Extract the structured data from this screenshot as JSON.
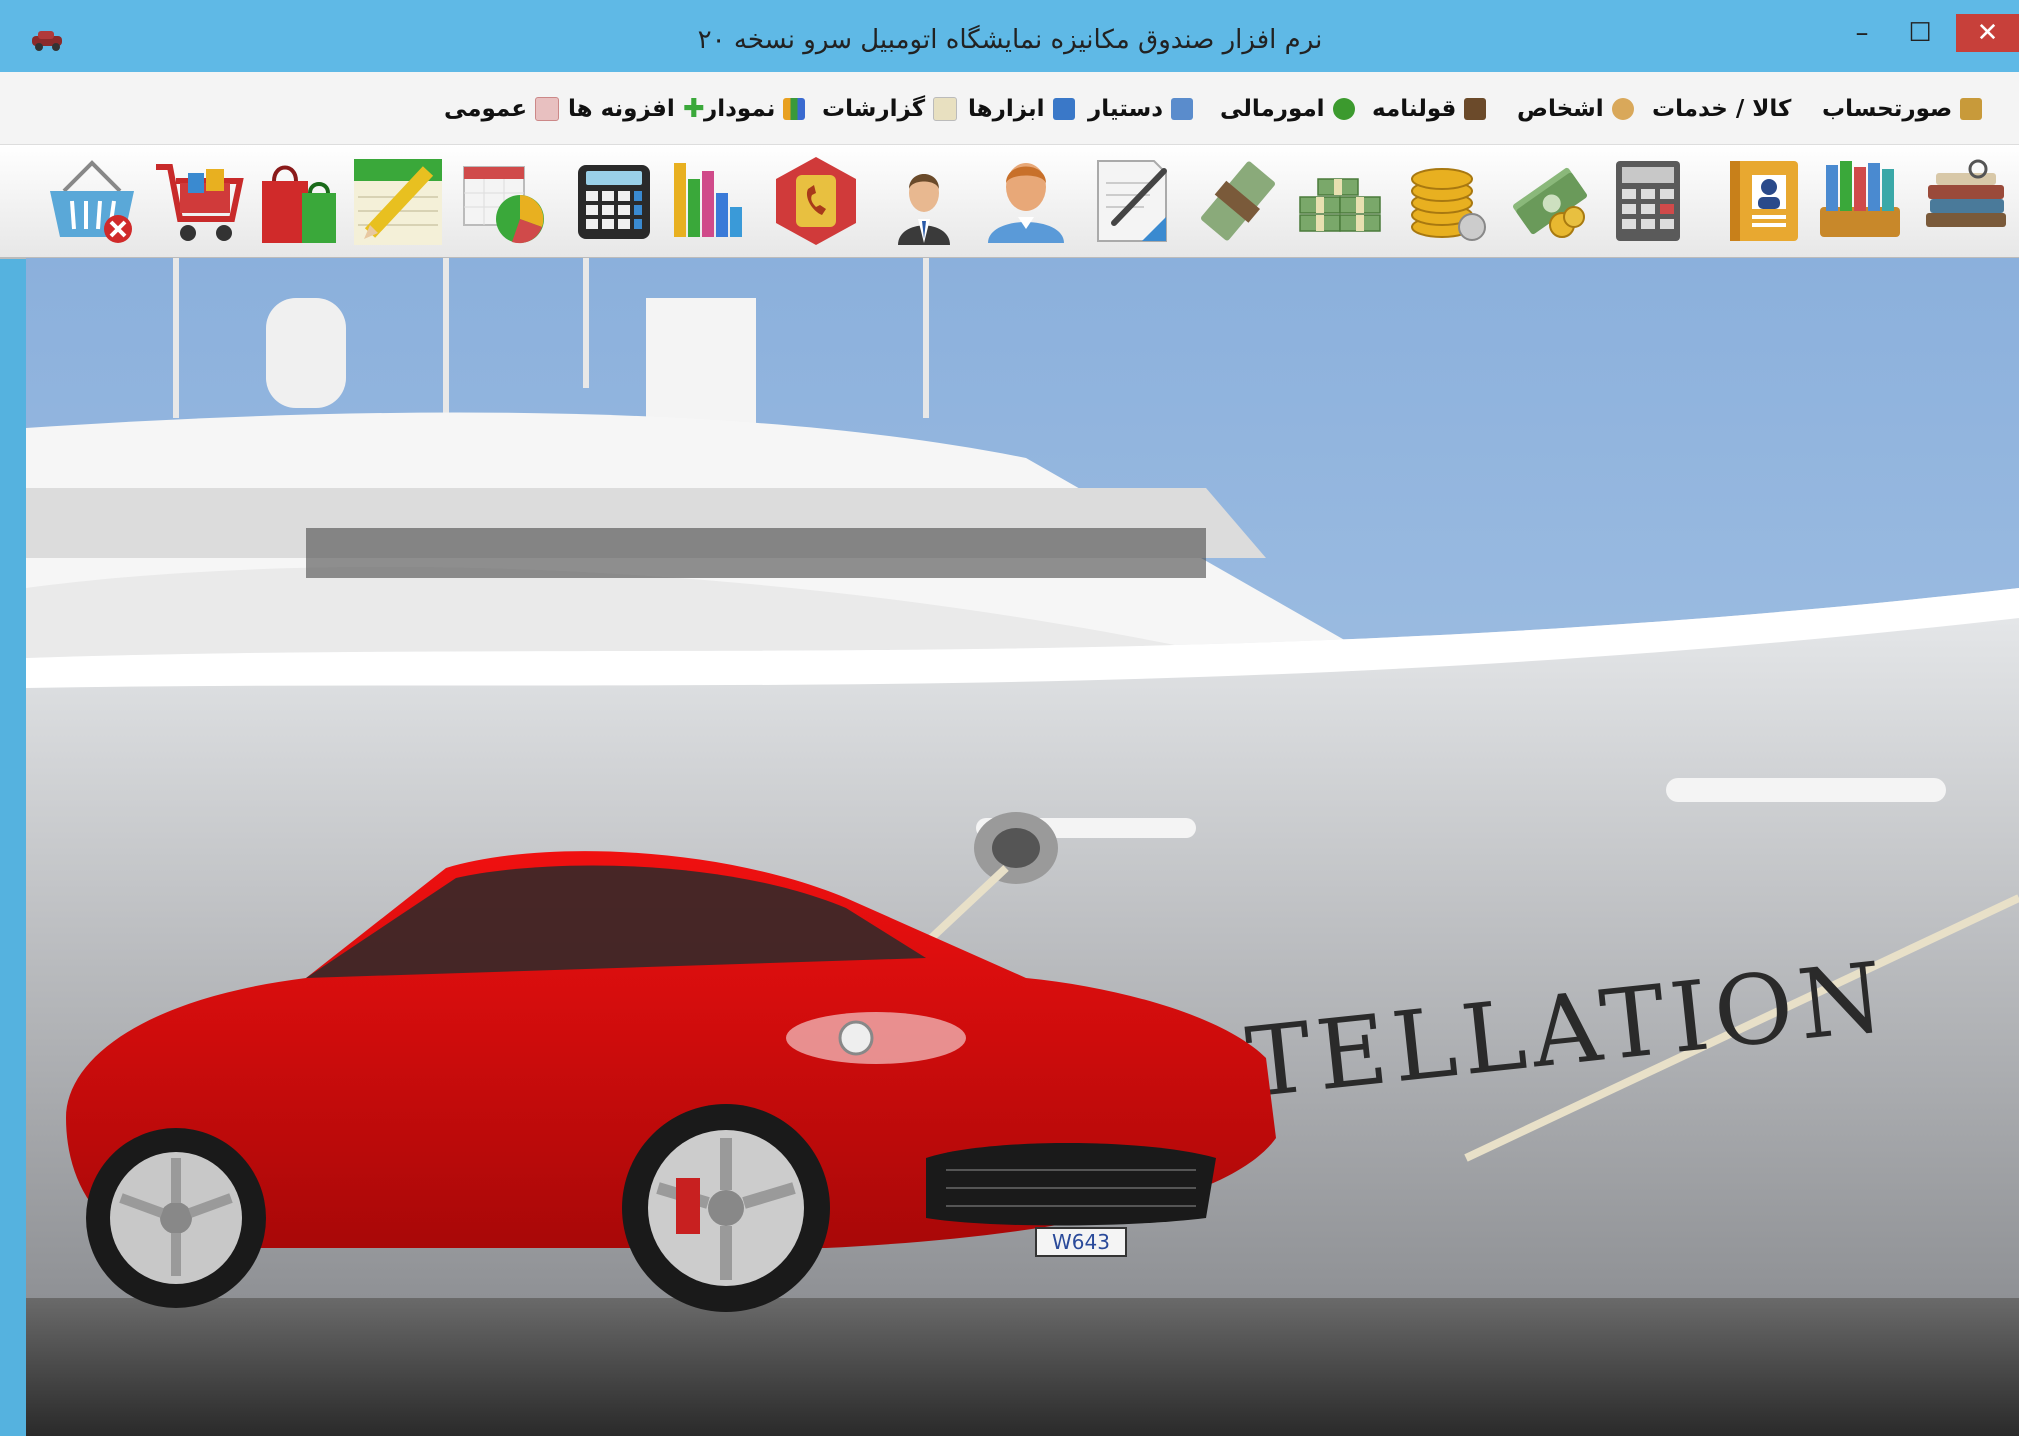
{
  "window": {
    "title": "نرم افزار صندوق مکانیزه نمایشگاه اتومبیل سرو نسخه ۲۰",
    "min_glyph": "–",
    "max_glyph": "☐",
    "close_glyph": "✕",
    "accent_color": "#5fb9e6",
    "close_color": "#c7403a"
  },
  "menu": [
    {
      "label": "صورتحساب",
      "icon": "invoice-icon"
    },
    {
      "label": "کالا / خدمات",
      "icon": ""
    },
    {
      "label": "اشخاص",
      "icon": "people-icon"
    },
    {
      "label": "قولنامه",
      "icon": "contract-icon"
    },
    {
      "label": "امورمالی",
      "icon": "dollar-icon"
    },
    {
      "label": "دستیار",
      "icon": "assistant-icon"
    },
    {
      "label": "ابزارها",
      "icon": "tools-icon"
    },
    {
      "label": "گزارشات",
      "icon": "report-icon"
    },
    {
      "label": "نمودار",
      "icon": "chart-icon"
    },
    {
      "label": "افزونه ها",
      "icon": "plus-icon"
    },
    {
      "label": "عمومی",
      "icon": "general-icon"
    }
  ],
  "toolbar": [
    "books-icon",
    "archive-folders-icon",
    "address-book-icon",
    "calculator-register-icon",
    "cash-coins-icon",
    "gold-coins-icon",
    "money-stack-icon",
    "money-wallet-icon",
    "document-pen-icon",
    "user-icon",
    "businessman-icon",
    "phone-book-icon",
    "bar-chart-icon",
    "calculator-icon",
    "calendar-chart-icon",
    "notepad-pencil-icon",
    "shopping-bags-icon",
    "shopping-cart-icon",
    "basket-remove-icon"
  ],
  "photo": {
    "ship_text": "STELLATION",
    "plate_text": "W643"
  }
}
